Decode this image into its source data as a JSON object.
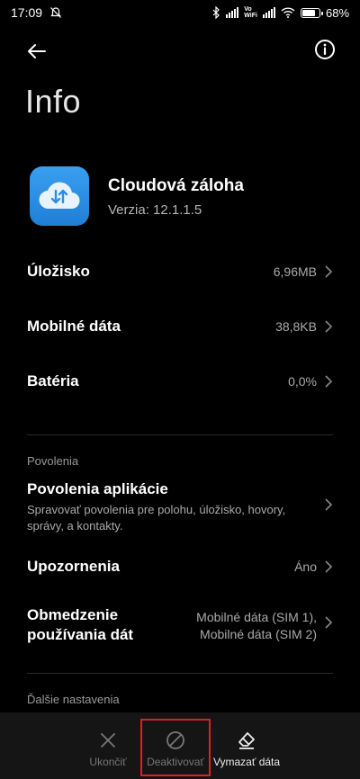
{
  "status_bar": {
    "time": "17:09",
    "battery": "68",
    "battery_fraction": 0.68,
    "vowifi": "Vo\nWiFi"
  },
  "header": {
    "title": "Info"
  },
  "app": {
    "name": "Cloudová záloha",
    "version": "Verzia: 12.1.1.5"
  },
  "rows": {
    "storage": {
      "label": "Úložisko",
      "value": "6,96MB"
    },
    "mobile_data": {
      "label": "Mobilné dáta",
      "value": "38,8KB"
    },
    "battery": {
      "label": "Batéria",
      "value": "0,0%"
    }
  },
  "permissions_section": {
    "label": "Povolenia",
    "app_permissions": {
      "title": "Povolenia aplikácie",
      "description": "Spravovať povolenia pre polohu, úložisko, hovory, správy, a kontakty."
    },
    "notifications": {
      "label": "Upozornenia",
      "value": "Áno"
    },
    "data_limit": {
      "label": "Obmedzenie používania dát",
      "value": "Mobilné dáta (SIM 1), Mobilné dáta (SIM 2)"
    }
  },
  "more_settings": {
    "label": "Ďalšie nastavenia"
  },
  "bottom_actions": {
    "stop": {
      "label": "Ukončiť",
      "icon": "close-icon"
    },
    "deactivate": {
      "label": "Deaktivovať",
      "icon": "block-icon"
    },
    "clear": {
      "label": "Vymazať dáta",
      "icon": "eraser-icon"
    }
  },
  "colors": {
    "background": "#000000",
    "app_icon": "#2a8ee8",
    "highlight": "#e02020"
  }
}
